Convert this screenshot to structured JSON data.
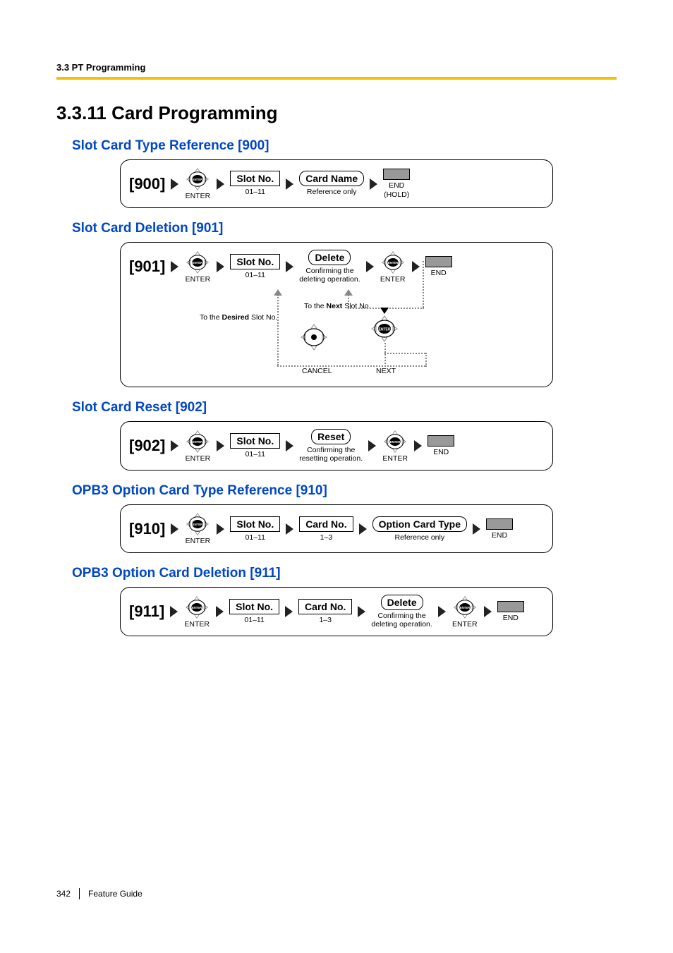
{
  "header": {
    "breadcrumb": "3.3 PT Programming"
  },
  "title": "3.3.11  Card Programming",
  "footer": {
    "page_number": "342",
    "doc_title": "Feature Guide"
  },
  "labels": {
    "enter": "ENTER",
    "end": "END",
    "end_hold": "END\n(HOLD)",
    "next": "NEXT",
    "cancel": "CANCEL"
  },
  "sections": [
    {
      "heading": "Slot Card Type Reference [900]",
      "code": "[900]",
      "steps": [
        {
          "type": "enter"
        },
        {
          "type": "chip",
          "text": "Slot No.",
          "sub": "01–11"
        },
        {
          "type": "chip_round",
          "text": "Card Name",
          "sub": "Reference only"
        },
        {
          "type": "end_hold"
        }
      ]
    },
    {
      "heading": "Slot Card Deletion [901]",
      "code": "[901]",
      "steps": [
        {
          "type": "enter"
        },
        {
          "type": "chip",
          "text": "Slot No.",
          "sub": "01–11"
        },
        {
          "type": "chip_round",
          "text": "Delete",
          "sub": "Confirming the\ndeleting operation."
        },
        {
          "type": "enter"
        },
        {
          "type": "end"
        }
      ],
      "extra": {
        "to_next": "To the Next Slot No.",
        "to_desired": "To the Desired Slot No."
      }
    },
    {
      "heading": "Slot Card Reset [902]",
      "code": "[902]",
      "steps": [
        {
          "type": "enter"
        },
        {
          "type": "chip",
          "text": "Slot No.",
          "sub": "01–11"
        },
        {
          "type": "chip_round",
          "text": "Reset",
          "sub": "Confirming the\nresetting operation."
        },
        {
          "type": "enter"
        },
        {
          "type": "end"
        }
      ]
    },
    {
      "heading": "OPB3 Option Card Type Reference [910]",
      "code": "[910]",
      "steps": [
        {
          "type": "enter"
        },
        {
          "type": "chip",
          "text": "Slot No.",
          "sub": "01–11"
        },
        {
          "type": "chip",
          "text": "Card No.",
          "sub": "1–3"
        },
        {
          "type": "chip_round",
          "text": "Option Card Type",
          "sub": "Reference only"
        },
        {
          "type": "end"
        }
      ]
    },
    {
      "heading": "OPB3 Option Card Deletion [911]",
      "code": "[911]",
      "steps": [
        {
          "type": "enter"
        },
        {
          "type": "chip",
          "text": "Slot No.",
          "sub": "01–11"
        },
        {
          "type": "chip",
          "text": "Card No.",
          "sub": "1–3"
        },
        {
          "type": "chip_round",
          "text": "Delete",
          "sub": "Confirming the\ndeleting operation."
        },
        {
          "type": "enter"
        },
        {
          "type": "end"
        }
      ]
    }
  ]
}
